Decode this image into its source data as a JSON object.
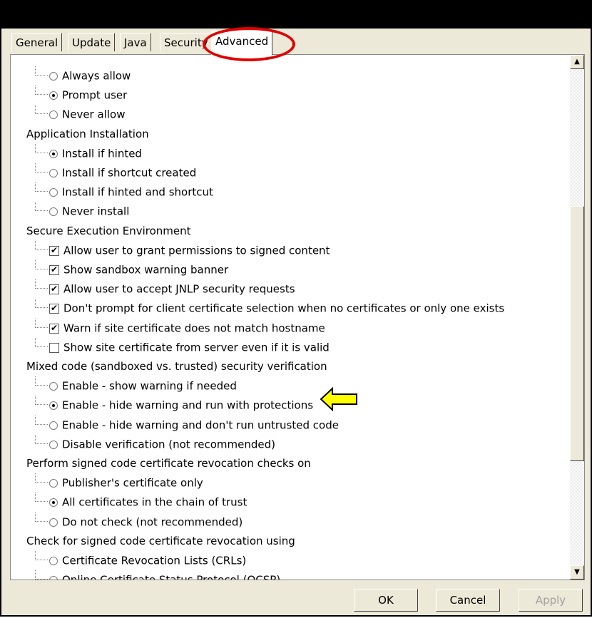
{
  "tabs": [
    {
      "label": "General",
      "active": false
    },
    {
      "label": "Update",
      "active": false
    },
    {
      "label": "Java",
      "active": false
    },
    {
      "label": "Security",
      "active": false
    },
    {
      "label": "Advanced",
      "active": true
    }
  ],
  "groups": [
    {
      "heading": null,
      "items": [
        {
          "type": "radio",
          "label": "Always allow",
          "checked": false
        },
        {
          "type": "radio",
          "label": "Prompt user",
          "checked": true
        },
        {
          "type": "radio",
          "label": "Never allow",
          "checked": false
        }
      ]
    },
    {
      "heading": "Application Installation",
      "items": [
        {
          "type": "radio",
          "label": "Install if hinted",
          "checked": true
        },
        {
          "type": "radio",
          "label": "Install if shortcut created",
          "checked": false
        },
        {
          "type": "radio",
          "label": "Install if hinted and shortcut",
          "checked": false
        },
        {
          "type": "radio",
          "label": "Never install",
          "checked": false
        }
      ]
    },
    {
      "heading": "Secure Execution Environment",
      "items": [
        {
          "type": "check",
          "label": "Allow user to grant permissions to signed content",
          "checked": true
        },
        {
          "type": "check",
          "label": "Show sandbox warning banner",
          "checked": true
        },
        {
          "type": "check",
          "label": "Allow user to accept JNLP security requests",
          "checked": true
        },
        {
          "type": "check",
          "label": "Don't prompt for client certificate selection when no certificates or only one exists",
          "checked": true
        },
        {
          "type": "check",
          "label": "Warn if site certificate does not match hostname",
          "checked": true
        },
        {
          "type": "check",
          "label": "Show site certificate from server even if it is valid",
          "checked": false
        }
      ]
    },
    {
      "heading": "Mixed code (sandboxed vs. trusted) security verification",
      "items": [
        {
          "type": "radio",
          "label": "Enable - show warning if needed",
          "checked": false
        },
        {
          "type": "radio",
          "label": "Enable - hide warning and run with protections",
          "checked": true
        },
        {
          "type": "radio",
          "label": "Enable - hide warning and don't run untrusted code",
          "checked": false
        },
        {
          "type": "radio",
          "label": "Disable verification (not recommended)",
          "checked": false
        }
      ]
    },
    {
      "heading": "Perform signed code certificate revocation checks on",
      "items": [
        {
          "type": "radio",
          "label": "Publisher's certificate only",
          "checked": false
        },
        {
          "type": "radio",
          "label": "All certificates in the chain of trust",
          "checked": true
        },
        {
          "type": "radio",
          "label": "Do not check (not recommended)",
          "checked": false
        }
      ]
    },
    {
      "heading": "Check for signed code certificate revocation using",
      "items": [
        {
          "type": "radio",
          "label": "Certificate Revocation Lists (CRLs)",
          "checked": false
        },
        {
          "type": "radio",
          "label": "Online Certificate Status Protocol (OCSP)",
          "checked": false
        }
      ]
    }
  ],
  "buttons": {
    "ok": "OK",
    "cancel": "Cancel",
    "apply": "Apply"
  },
  "colors": {
    "highlight_ellipse": "#e00000",
    "arrow_fill": "#ffff00"
  }
}
